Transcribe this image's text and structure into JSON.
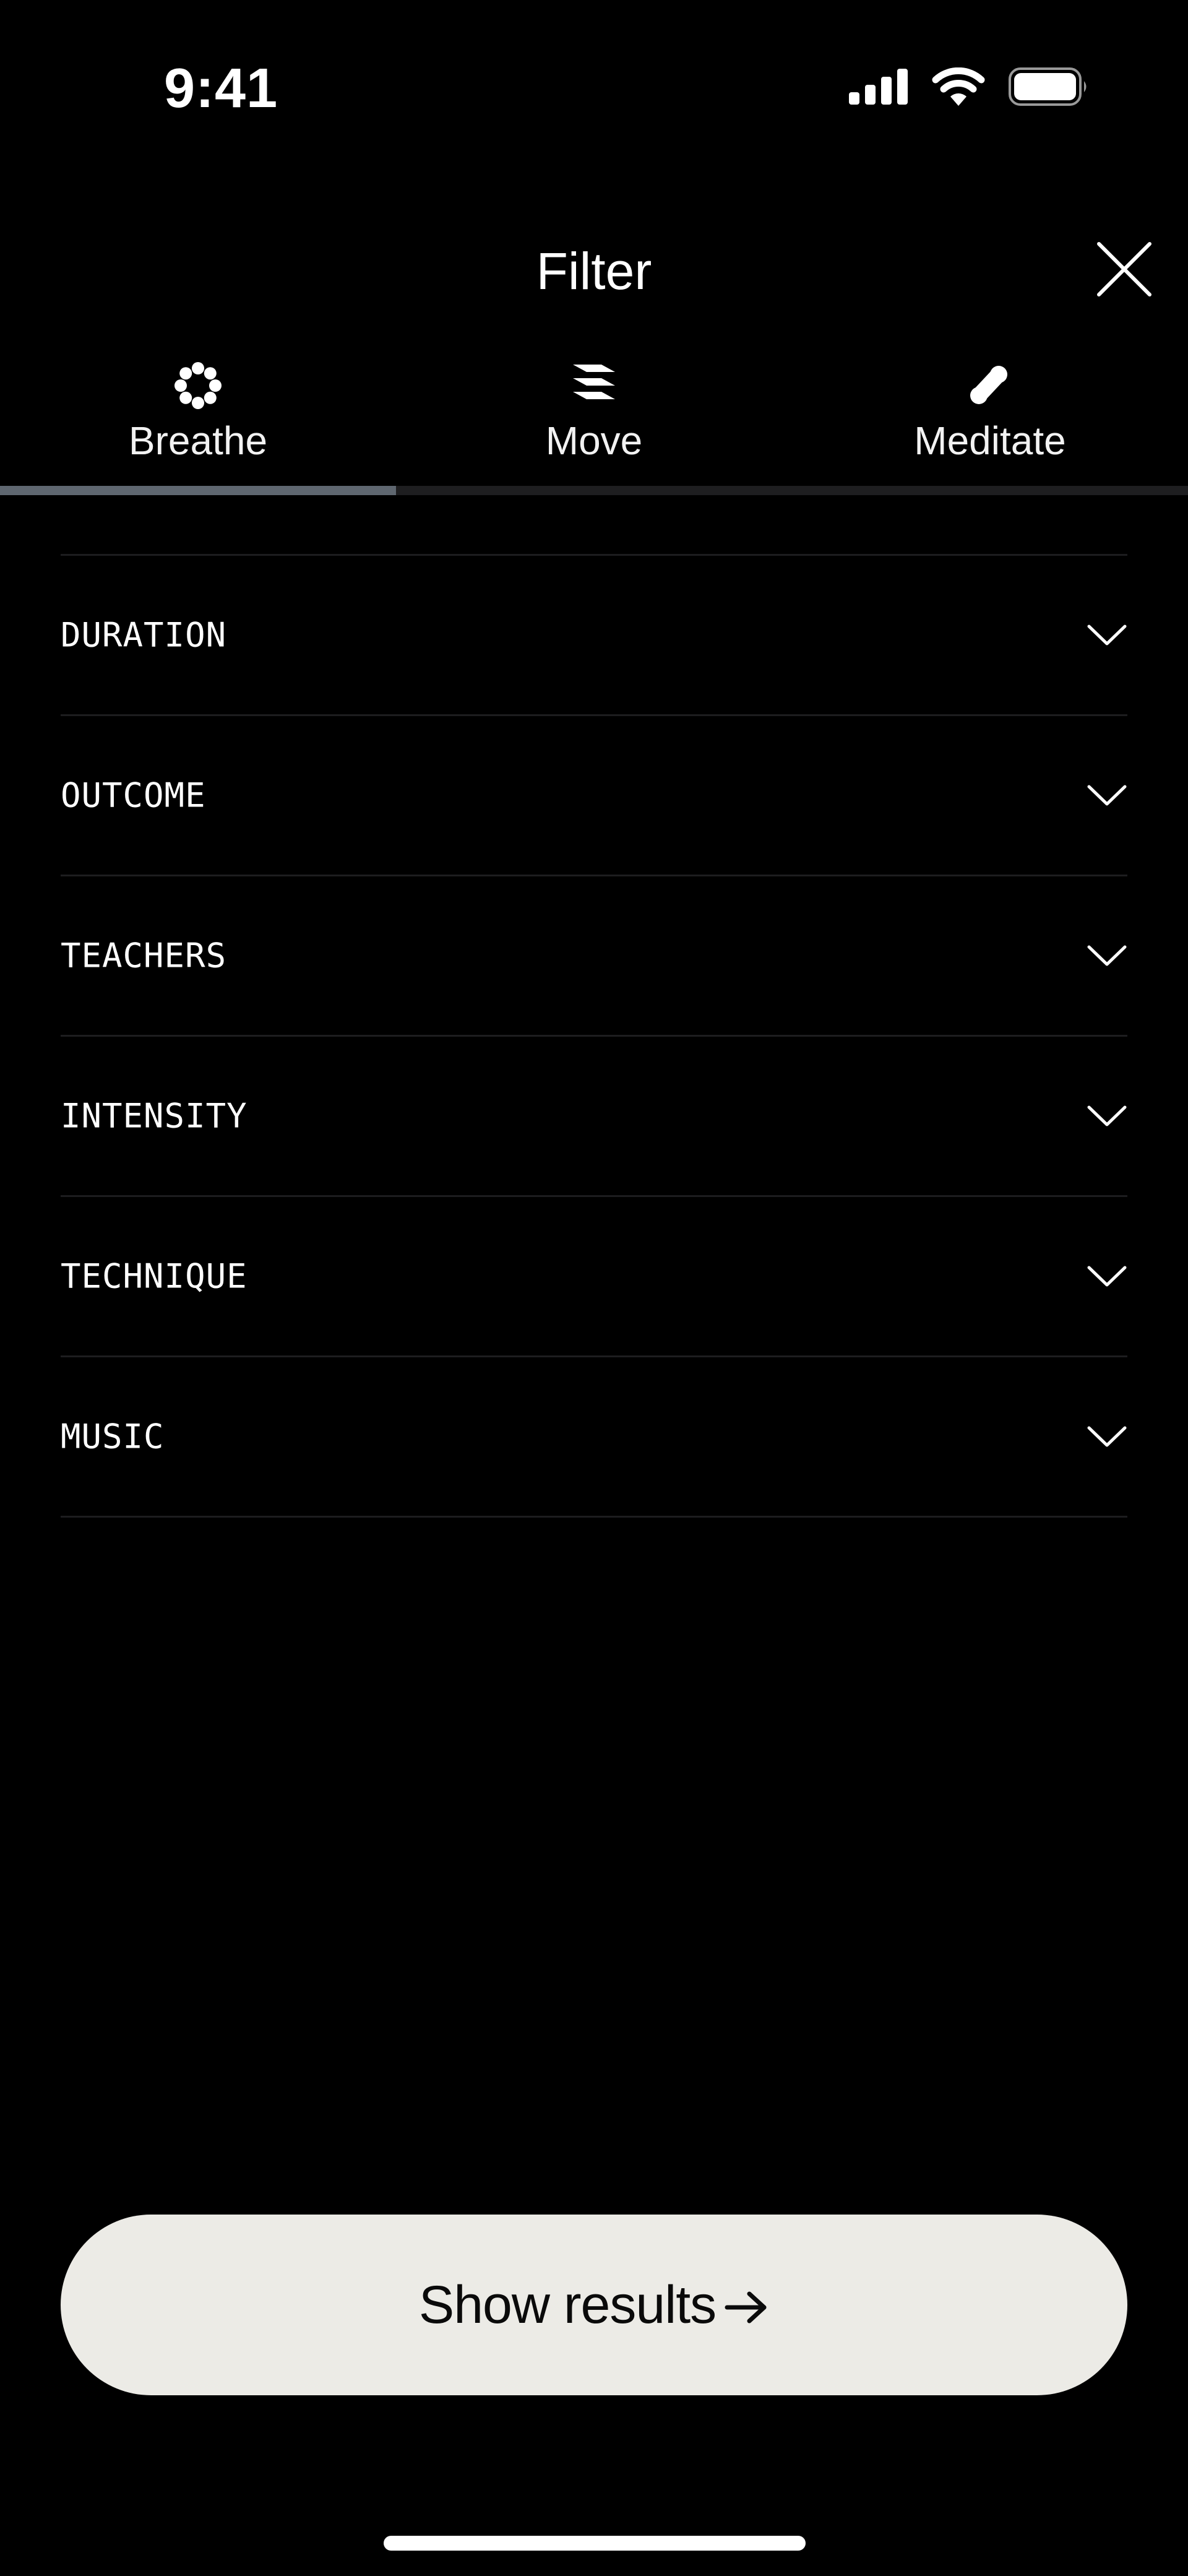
{
  "status_bar": {
    "time": "9:41"
  },
  "header": {
    "title": "Filter"
  },
  "tabs": [
    {
      "label": "Breathe",
      "icon": "breathe-icon",
      "active": true
    },
    {
      "label": "Move",
      "icon": "move-icon",
      "active": false
    },
    {
      "label": "Meditate",
      "icon": "meditate-icon",
      "active": false
    }
  ],
  "filters": [
    {
      "label": "DURATION"
    },
    {
      "label": "OUTCOME"
    },
    {
      "label": "TEACHERS"
    },
    {
      "label": "INTENSITY"
    },
    {
      "label": "TECHNIQUE"
    },
    {
      "label": "MUSIC"
    }
  ],
  "actions": {
    "show_results": "Show results"
  },
  "colors": {
    "background": "#000000",
    "text": "#ffffff",
    "button_bg": "#ecebe6",
    "button_text": "#0a0a0a",
    "divider": "#1d1d1f",
    "tab_indicator": "#5f6770"
  }
}
